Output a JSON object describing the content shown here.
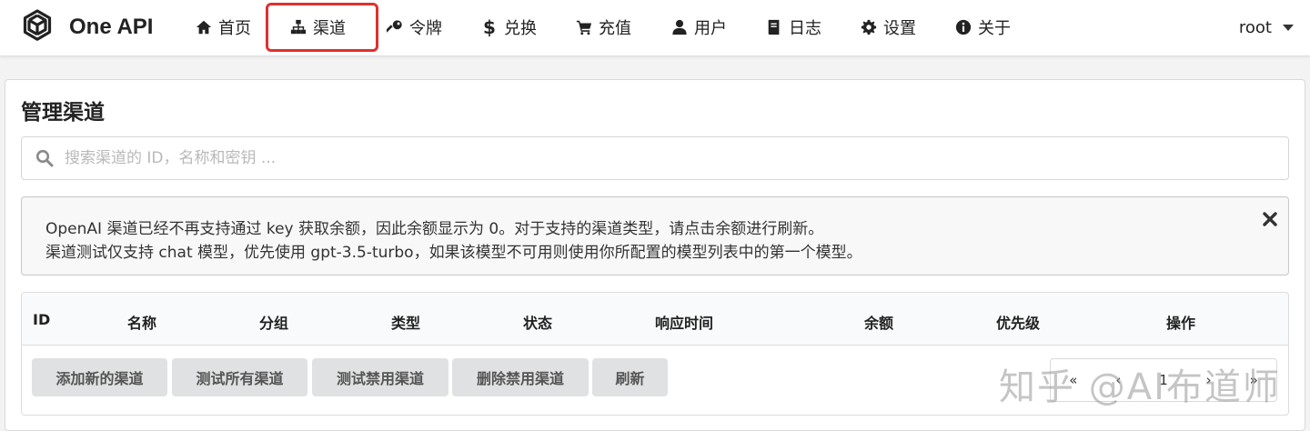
{
  "app": {
    "name": "One API"
  },
  "nav": {
    "items": [
      {
        "label": "首页",
        "icon": "home-icon"
      },
      {
        "label": "渠道",
        "icon": "sitemap-icon"
      },
      {
        "label": "令牌",
        "icon": "key-icon"
      },
      {
        "label": "兑换",
        "icon": "dollar-icon"
      },
      {
        "label": "充值",
        "icon": "cart-icon"
      },
      {
        "label": "用户",
        "icon": "user-icon"
      },
      {
        "label": "日志",
        "icon": "book-icon"
      },
      {
        "label": "设置",
        "icon": "gear-icon"
      },
      {
        "label": "关于",
        "icon": "info-icon"
      }
    ],
    "active_index": 1,
    "highlight_color": "#e03030",
    "user": "root"
  },
  "page": {
    "title": "管理渠道"
  },
  "search": {
    "placeholder": "搜索渠道的 ID，名称和密钥 ..."
  },
  "notice": {
    "line1": "OpenAI 渠道已经不再支持通过 key 获取余额，因此余额显示为 0。对于支持的渠道类型，请点击余额进行刷新。",
    "line2": "渠道测试仅支持 chat 模型，优先使用 gpt-3.5-turbo，如果该模型不可用则使用你所配置的模型列表中的第一个模型。"
  },
  "table": {
    "columns": [
      "ID",
      "名称",
      "分组",
      "类型",
      "状态",
      "响应时间",
      "余额",
      "优先级",
      "操作"
    ]
  },
  "actions": [
    "添加新的渠道",
    "测试所有渠道",
    "测试禁用渠道",
    "删除禁用渠道",
    "刷新"
  ],
  "pagination": [
    "«",
    "‹",
    "1",
    "›",
    "»"
  ],
  "watermark": "知乎 @AI布道师"
}
